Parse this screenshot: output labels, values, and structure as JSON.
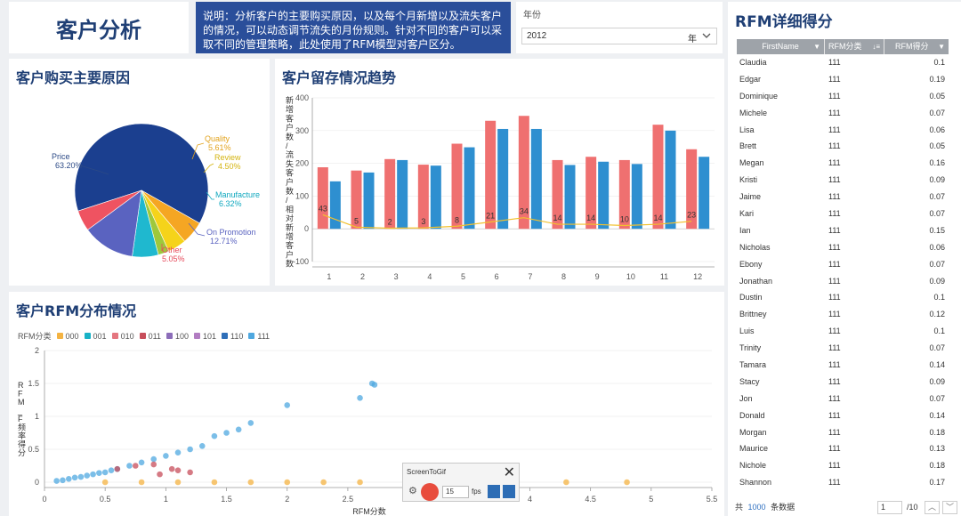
{
  "header": {
    "title": "客户分析",
    "description": "说明：分析客户的主要购买原因，以及每个月新增以及流失客户的情况，可以动态调节流失的月份规则。针对不同的客户可以采取不同的管理策略，此处使用了RFM模型对客户区分。",
    "year_label": "年份",
    "year_value": "2012",
    "year_unit": "年"
  },
  "pie": {
    "title": "客户购买主要原因",
    "labels": [
      {
        "name": "Price",
        "pct": "63.20%"
      },
      {
        "name": "Quality",
        "pct": "5.61%"
      },
      {
        "name": "Review",
        "pct": "4.50%"
      },
      {
        "name": "Manufacture",
        "pct": "6.32%"
      },
      {
        "name": "On Promotion",
        "pct": "12.71%"
      },
      {
        "name": "Other",
        "pct": "5.05%"
      }
    ]
  },
  "bar": {
    "title": "客户留存情况趋势",
    "ylabel": "新增客户数/流失客户数/相对新增客户数"
  },
  "scatter": {
    "title": "客户RFM分布情况",
    "legend_title": "RFM分类",
    "xlabel": "RFM分数",
    "ylabel": "RFM_F频率得分"
  },
  "table": {
    "title": "RFM详细得分",
    "columns": [
      "FirstName",
      "RFM分类",
      "RFM得分"
    ],
    "rows": [
      [
        "Claudia",
        "111",
        "0.1"
      ],
      [
        "Edgar",
        "111",
        "0.19"
      ],
      [
        "Dominique",
        "111",
        "0.05"
      ],
      [
        "Michele",
        "111",
        "0.07"
      ],
      [
        "Lisa",
        "111",
        "0.06"
      ],
      [
        "Brett",
        "111",
        "0.05"
      ],
      [
        "Megan",
        "111",
        "0.16"
      ],
      [
        "Kristi",
        "111",
        "0.09"
      ],
      [
        "Jaime",
        "111",
        "0.07"
      ],
      [
        "Kari",
        "111",
        "0.07"
      ],
      [
        "Ian",
        "111",
        "0.15"
      ],
      [
        "Nicholas",
        "111",
        "0.06"
      ],
      [
        "Ebony",
        "111",
        "0.07"
      ],
      [
        "Jonathan",
        "111",
        "0.09"
      ],
      [
        "Dustin",
        "111",
        "0.1"
      ],
      [
        "Brittney",
        "111",
        "0.12"
      ],
      [
        "Luis",
        "111",
        "0.1"
      ],
      [
        "Trinity",
        "111",
        "0.07"
      ],
      [
        "Tamara",
        "111",
        "0.14"
      ],
      [
        "Stacy",
        "111",
        "0.09"
      ],
      [
        "Jon",
        "111",
        "0.07"
      ],
      [
        "Donald",
        "111",
        "0.14"
      ],
      [
        "Morgan",
        "111",
        "0.18"
      ],
      [
        "Maurice",
        "111",
        "0.13"
      ],
      [
        "Nichole",
        "111",
        "0.18"
      ],
      [
        "Shannon",
        "111",
        "0.17"
      ]
    ],
    "footer_prefix": "共",
    "footer_count": "1000",
    "footer_suffix": "条数据",
    "page_current": "1",
    "page_total": "/10"
  },
  "gif": {
    "title": "ScreenToGif",
    "fps_value": "15",
    "fps_label": "fps"
  },
  "colors": {
    "title": "#1f3f75",
    "desc_bg": "#2a4e9a",
    "bar_new": "#ef7070",
    "bar_lost": "#2e8fd0",
    "line": "#f2c12e"
  },
  "chart_data": [
    {
      "type": "pie",
      "title": "客户购买主要原因",
      "categories": [
        "Price",
        "Quality",
        "Review",
        "Manufacture",
        "On Promotion",
        "Other"
      ],
      "values": [
        63.2,
        5.61,
        4.5,
        6.32,
        12.71,
        5.05
      ],
      "unlabeled_slice": 2.61,
      "colors": [
        "#1b3f8f",
        "#f5a623",
        "#f5d31a",
        "#9ec83c",
        "#1fb8cf",
        "#5a63c0",
        "#ef5361"
      ]
    },
    {
      "type": "bar",
      "title": "客户留存情况趋势",
      "ylabel": "新增客户数/流失客户数/相对新增客户数",
      "categories": [
        "1",
        "2",
        "3",
        "4",
        "5",
        "6",
        "7",
        "8",
        "9",
        "10",
        "11",
        "12"
      ],
      "ylim": [
        -100,
        400
      ],
      "yticks": [
        -100,
        0,
        100,
        200,
        300,
        400
      ],
      "series": [
        {
          "values": [
            188,
            178,
            213,
            196,
            260,
            330,
            345,
            210,
            220,
            210,
            318,
            243
          ]
        },
        {
          "values": [
            145,
            172,
            210,
            193,
            249,
            305,
            305,
            195,
            205,
            198,
            300,
            220
          ]
        },
        {
          "values": [
            43,
            5,
            2,
            3,
            8,
            21,
            34,
            14,
            14,
            10,
            14,
            23
          ]
        }
      ]
    },
    {
      "type": "scatter",
      "title": "客户RFM分布情况",
      "xlabel": "RFM分数",
      "ylabel": "RFM_F频率得分",
      "xlim": [
        0,
        5.5
      ],
      "ylim": [
        0,
        2
      ],
      "xticks": [
        0,
        0.5,
        1,
        1.5,
        2,
        2.5,
        3,
        3.5,
        4,
        4.5,
        5,
        5.5
      ],
      "yticks": [
        0,
        0.5,
        1,
        1.5,
        2
      ],
      "legend_title": "RFM分类",
      "legend": [
        "000",
        "001",
        "010",
        "011",
        "100",
        "101",
        "110",
        "111"
      ],
      "legend_colors": [
        "#f4b342",
        "#19b2c6",
        "#e4767f",
        "#c74e5b",
        "#8c6db9",
        "#b27dc2",
        "#2f6fb9",
        "#4fa8e0"
      ],
      "series": [
        {
          "name": "111",
          "x": [
            0.1,
            0.15,
            0.2,
            0.25,
            0.3,
            0.35,
            0.4,
            0.45,
            0.5,
            0.55,
            0.6,
            0.7,
            0.8,
            0.9,
            1.0,
            1.1,
            1.2,
            1.3,
            1.4,
            1.5,
            1.6,
            1.7,
            2.0,
            2.6,
            2.7,
            2.72
          ],
          "y": [
            0.02,
            0.03,
            0.05,
            0.07,
            0.08,
            0.1,
            0.12,
            0.14,
            0.15,
            0.18,
            0.2,
            0.25,
            0.3,
            0.35,
            0.4,
            0.45,
            0.5,
            0.55,
            0.7,
            0.75,
            0.8,
            0.9,
            1.17,
            1.28,
            1.5,
            1.48
          ]
        },
        {
          "name": "011",
          "x": [
            0.6,
            0.75,
            0.9,
            1.05,
            1.2,
            0.95,
            1.1
          ],
          "y": [
            0.2,
            0.25,
            0.27,
            0.2,
            0.15,
            0.12,
            0.18
          ]
        },
        {
          "name": "000",
          "x": [
            0.5,
            0.8,
            1.1,
            1.4,
            1.7,
            2.0,
            2.3,
            2.6,
            3.0,
            3.4,
            3.8,
            4.3,
            4.8
          ],
          "y": [
            0,
            0,
            0,
            0,
            0,
            0,
            0,
            0,
            0,
            0,
            0,
            0,
            0
          ]
        }
      ]
    }
  ]
}
